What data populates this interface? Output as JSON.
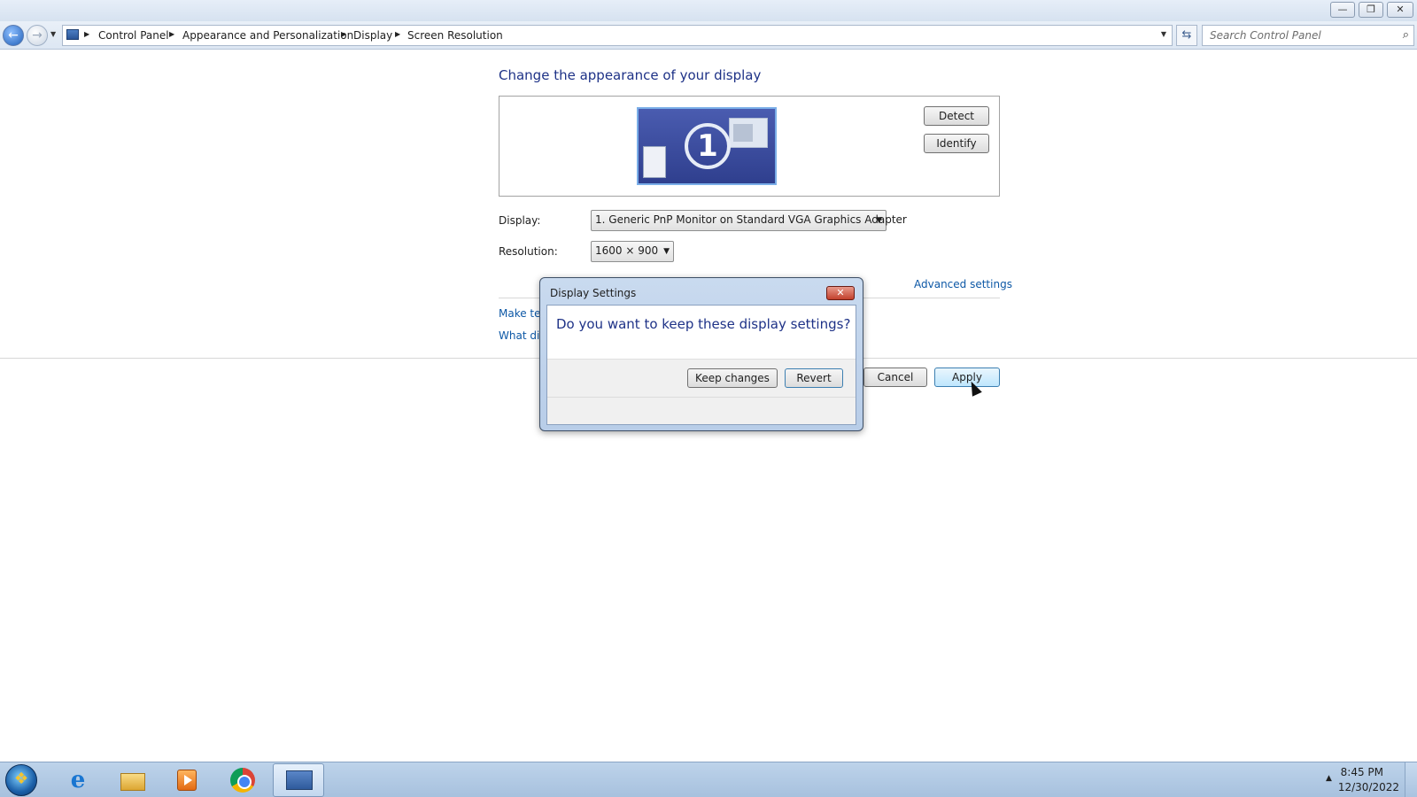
{
  "window": {
    "minimize_glyph": "—",
    "restore_glyph": "❐",
    "close_glyph": "✕"
  },
  "address": {
    "breadcrumbs": [
      "Control Panel",
      "Appearance and Personalization",
      "Display",
      "Screen Resolution"
    ],
    "search_placeholder": "Search Control Panel"
  },
  "main": {
    "heading": "Change the appearance of your display",
    "monitor_number": "1",
    "detect_label": "Detect",
    "identify_label": "Identify",
    "display_label": "Display:",
    "display_value": "1. Generic PnP Monitor on Standard VGA Graphics Adapter",
    "resolution_label": "Resolution:",
    "resolution_value": "1600 × 900",
    "advanced_link": "Advanced settings",
    "link_text_size": "Make tex",
    "link_what_display": "What dis",
    "cancel_label": "Cancel",
    "apply_label": "Apply"
  },
  "dialog": {
    "title": "Display Settings",
    "message": "Do you want to keep these display settings?",
    "keep_label": "Keep changes",
    "revert_label": "Revert"
  },
  "taskbar": {
    "time": "8:45 PM",
    "date": "12/30/2022",
    "ie_glyph": "e",
    "tray_glyph": "▲"
  },
  "icons": {
    "back": "back-arrow-icon",
    "forward": "forward-arrow-icon",
    "refresh": "refresh-icon",
    "search": "search-icon"
  }
}
